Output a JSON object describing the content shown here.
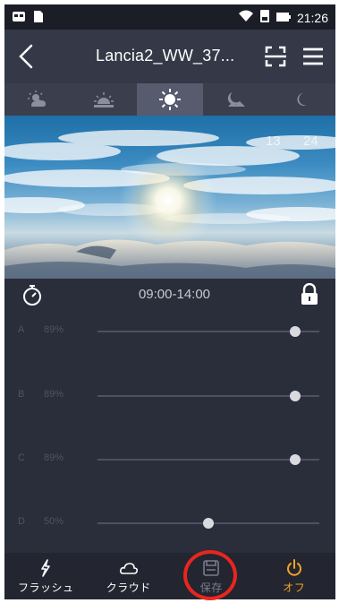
{
  "status_bar": {
    "time": "21:26",
    "icons": [
      "notification-icon",
      "sim-icon",
      "wifi-icon",
      "battery-saver-icon",
      "battery-icon"
    ]
  },
  "header": {
    "title": "Lancia2_WW_37...",
    "back_icon": "back-chevron-icon",
    "scan_icon": "scan-icon",
    "menu_icon": "menu-icon"
  },
  "mode_tabs": [
    {
      "icon": "sunrise-cloud-icon",
      "active": false
    },
    {
      "icon": "sunrise-icon",
      "active": false
    },
    {
      "icon": "sun-icon",
      "active": true
    },
    {
      "icon": "sunset-icon",
      "active": false
    },
    {
      "icon": "moon-icon",
      "active": false
    }
  ],
  "scene": {
    "time_start": "13",
    "time_end": "24"
  },
  "controls": {
    "time_range": "09:00-14:00",
    "timer_icon": "timer-icon",
    "lock_icon": "lock-icon"
  },
  "channels": [
    {
      "letter": "A",
      "value_label": "89%",
      "value": 0.89
    },
    {
      "letter": "B",
      "value_label": "89%",
      "value": 0.89
    },
    {
      "letter": "C",
      "value_label": "89%",
      "value": 0.89
    },
    {
      "letter": "D",
      "value_label": "50%",
      "value": 0.5
    }
  ],
  "bottom_nav": [
    {
      "label": "フラッシュ",
      "icon": "flash-icon"
    },
    {
      "label": "クラウド",
      "icon": "cloud-icon"
    },
    {
      "label": "保存",
      "icon": "save-icon"
    },
    {
      "label": "オフ",
      "icon": "power-icon"
    }
  ],
  "colors": {
    "accent_off": "#f1a324",
    "highlight_ring": "#e8261e",
    "active_tab": "#565b6d"
  }
}
